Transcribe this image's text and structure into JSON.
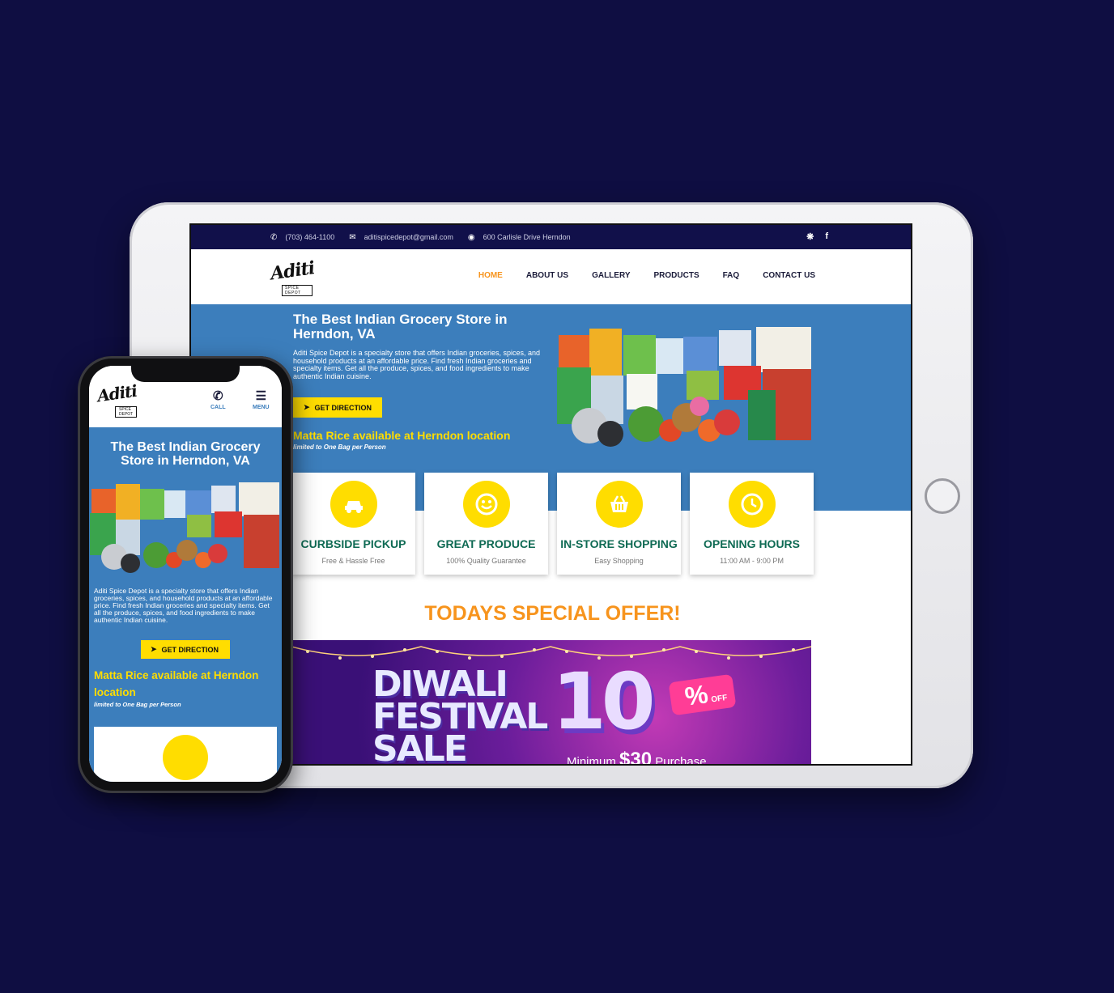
{
  "tablet": {
    "topbar": {
      "phone": "(703) 464-1100",
      "email": "aditispicedepot@gmail.com",
      "address": "600 Carlisle Drive Herndon",
      "social": [
        "yelp-icon",
        "facebook-icon"
      ]
    },
    "logo": {
      "script": "Aditi",
      "sub": "SPICE DEPOT"
    },
    "menu": [
      {
        "label": "HOME",
        "active": true
      },
      {
        "label": "ABOUT US"
      },
      {
        "label": "GALLERY"
      },
      {
        "label": "PRODUCTS"
      },
      {
        "label": "FAQ"
      },
      {
        "label": "CONTACT US"
      }
    ],
    "hero": {
      "title": "The Best Indian Grocery Store in Herndon, VA",
      "description": "Aditi Spice Depot is a specialty store that offers Indian groceries, spices, and household products at an affordable price. Find fresh Indian groceries and specialty items. Get all the produce, spices, and food ingredients to make authentic Indian cuisine.",
      "button": "GET DIRECTION",
      "announcement": "Matta Rice available at Herndon location",
      "announcement_note": "limited to One Bag per Person"
    },
    "features": [
      {
        "title": "CURBSIDE PICKUP",
        "subtitle": "Free & Hassle Free",
        "icon": "car-icon"
      },
      {
        "title": "GREAT PRODUCE",
        "subtitle": "100% Quality Guarantee",
        "icon": "smile-icon"
      },
      {
        "title": "IN-STORE SHOPPING",
        "subtitle": "Easy Shopping",
        "icon": "basket-icon"
      },
      {
        "title": "OPENING HOURS",
        "subtitle": "11:00 AM - 9:00 PM",
        "icon": "clock-icon"
      }
    ],
    "offer_heading": "TODAYS SPECIAL OFFER!",
    "banner": {
      "line1": "DIWALI",
      "line2": "FESTIVAL",
      "line3": "SALE",
      "discount": "10",
      "percent": "%",
      "off": "OFF",
      "minimum_prefix": "Minimum",
      "minimum_amount": "$30",
      "minimum_suffix": "Purchase"
    }
  },
  "phone": {
    "logo": {
      "script": "Aditi",
      "sub": "SPICE DEPOT"
    },
    "call_label": "CALL",
    "menu_label": "MENU",
    "hero": {
      "title": "The Best Indian Grocery Store in Herndon, VA",
      "description": "Aditi Spice Depot is a specialty store that offers Indian groceries, spices, and household products at an affordable price. Find fresh Indian groceries and specialty items. Get all the produce, spices, and food ingredients to make authentic Indian cuisine.",
      "button": "GET DIRECTION",
      "announcement": "Matta Rice available at Herndon location",
      "announcement_note": "limited to One Bag per Person"
    }
  },
  "colors": {
    "background": "#0f0e42",
    "topbar": "#11104a",
    "hero_blue": "#3c7ebc",
    "accent_yellow": "#ffdd00",
    "accent_orange": "#f7941d",
    "feature_green": "#0e6a53"
  }
}
